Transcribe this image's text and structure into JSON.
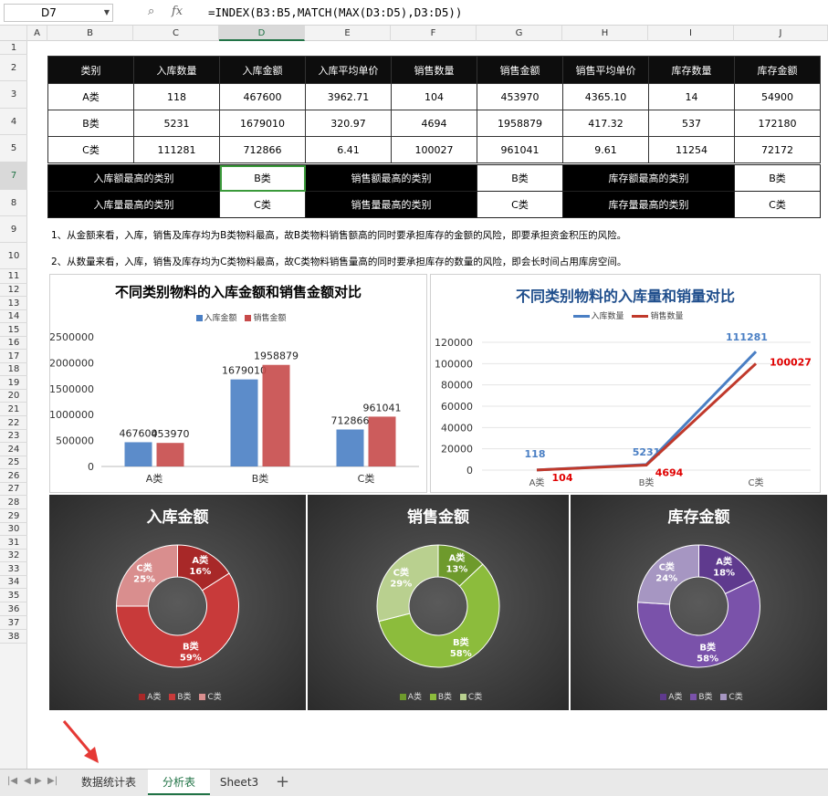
{
  "formula_bar": {
    "cell_ref": "D7",
    "formula": "=INDEX(B3:B5,MATCH(MAX(D3:D5),D3:D5))",
    "fx": "fx",
    "search_glyph": "⌕"
  },
  "columns": [
    "A",
    "B",
    "C",
    "D",
    "E",
    "F",
    "G",
    "H",
    "I",
    "J"
  ],
  "rows": [
    "1",
    "2",
    "3",
    "4",
    "5",
    "7",
    "8",
    "9",
    "10",
    "11",
    "12",
    "13",
    "14",
    "15",
    "16",
    "17",
    "18",
    "19",
    "20",
    "21",
    "22",
    "23",
    "24",
    "25",
    "26",
    "27",
    "28",
    "29",
    "30",
    "31",
    "32",
    "33",
    "34",
    "35",
    "36",
    "37",
    "38"
  ],
  "table": {
    "headers": [
      "类别",
      "入库数量",
      "入库金额",
      "入库平均单价",
      "销售数量",
      "销售金额",
      "销售平均单价",
      "库存数量",
      "库存金额"
    ],
    "rows": [
      [
        "A类",
        "118",
        "467600",
        "3962.71",
        "104",
        "453970",
        "4365.10",
        "14",
        "54900"
      ],
      [
        "B类",
        "5231",
        "1679010",
        "320.97",
        "4694",
        "1958879",
        "417.32",
        "537",
        "172180"
      ],
      [
        "C类",
        "111281",
        "712866",
        "6.41",
        "100027",
        "961041",
        "9.61",
        "11254",
        "72172"
      ]
    ]
  },
  "summary": [
    [
      "入库额最高的类别",
      "B类",
      "销售额最高的类别",
      "B类",
      "库存额最高的类别",
      "B类"
    ],
    [
      "入库量最高的类别",
      "C类",
      "销售量最高的类别",
      "C类",
      "库存量最高的类别",
      "C类"
    ]
  ],
  "notes": [
    "1、从金额来看，入库，销售及库存均为B类物料最高，故B类物料销售额高的同时要承担库存的金额的风险，即要承担资金积压的风险。",
    "2、从数量来看，入库，销售及库存均为C类物料最高，故C类物料销售量高的同时要承担库存的数量的风险，即会长时间占用库房空间。"
  ],
  "chart_data": [
    {
      "type": "bar",
      "title": "不同类别物料的入库金额和销售金额对比",
      "categories": [
        "A类",
        "B类",
        "C类"
      ],
      "series": [
        {
          "name": "入库金额",
          "values": [
            467600,
            1679010,
            712866
          ],
          "labels": [
            "467600",
            "1679010",
            "712866"
          ],
          "color": "#4a7fc4"
        },
        {
          "name": "销售金额",
          "values": [
            453970,
            1958879,
            961041
          ],
          "labels": [
            "453970",
            "1958879",
            "961041"
          ],
          "color": "#c74a4a"
        }
      ],
      "yticks": [
        "0",
        "500000",
        "1000000",
        "1500000",
        "2000000",
        "2500000"
      ],
      "ylim": [
        0,
        2500000
      ],
      "grid": false,
      "legend": "top"
    },
    {
      "type": "line",
      "title": "不同类别物料的入库量和销量对比",
      "categories": [
        "A类",
        "B类",
        "C类"
      ],
      "series": [
        {
          "name": "入库数量",
          "values": [
            118,
            5231,
            111281
          ],
          "labels": [
            "118",
            "5231",
            "111281"
          ],
          "color": "#4a7fc4"
        },
        {
          "name": "销售数量",
          "values": [
            104,
            4694,
            100027
          ],
          "labels": [
            "104",
            "4694",
            "100027"
          ],
          "color": "#c0392b"
        }
      ],
      "yticks": [
        "0",
        "20000",
        "40000",
        "60000",
        "80000",
        "100000",
        "120000"
      ],
      "ylim": [
        0,
        120000
      ],
      "grid": true,
      "legend": "top"
    },
    {
      "type": "pie",
      "title": "入库金额",
      "categories": [
        "A类",
        "B类",
        "C类"
      ],
      "values": [
        16,
        59,
        25
      ],
      "labels": [
        "A类\n16%",
        "B类\n59%",
        "C类\n25%"
      ],
      "colors": [
        "#a82828",
        "#c83a3a",
        "#d98e8e"
      ],
      "legend": "bottom"
    },
    {
      "type": "pie",
      "title": "销售金额",
      "categories": [
        "A类",
        "B类",
        "C类"
      ],
      "values": [
        13,
        58,
        29
      ],
      "labels": [
        "A类\n13%",
        "B类\n58%",
        "C类\n29%"
      ],
      "colors": [
        "#6e9a2c",
        "#8cbc3c",
        "#b9d08f"
      ],
      "legend": "bottom"
    },
    {
      "type": "pie",
      "title": "库存金额",
      "categories": [
        "A类",
        "B类",
        "C类"
      ],
      "values": [
        18,
        58,
        24
      ],
      "labels": [
        "A类\n18%",
        "B类\n58%",
        "C类\n24%"
      ],
      "colors": [
        "#5f3a8e",
        "#7a52aa",
        "#a696c2"
      ],
      "legend": "bottom"
    }
  ],
  "sheet_tabs": [
    "数据统计表",
    "分析表",
    "Sheet3"
  ],
  "active_tab": "分析表",
  "plus": "+"
}
